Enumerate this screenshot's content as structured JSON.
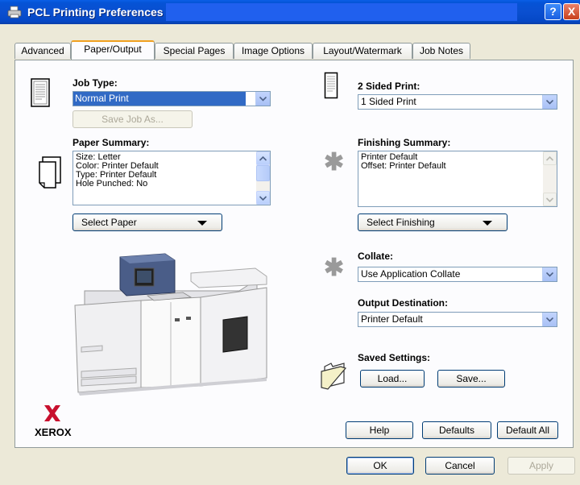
{
  "window": {
    "title": "PCL Printing Preferences",
    "help_glyph": "?",
    "close_glyph": "X"
  },
  "tabs": [
    {
      "label": "Advanced"
    },
    {
      "label": "Paper/Output",
      "active": true
    },
    {
      "label": "Special Pages"
    },
    {
      "label": "Image Options"
    },
    {
      "label": "Layout/Watermark"
    },
    {
      "label": "Job Notes"
    }
  ],
  "job_type": {
    "label": "Job Type:",
    "value": "Normal Print",
    "save_job_as": "Save Job As..."
  },
  "paper_summary": {
    "label": "Paper Summary:",
    "lines": [
      "Size: Letter",
      "Color: Printer Default",
      "Type: Printer Default",
      "Hole Punched: No"
    ],
    "select_button": "Select Paper"
  },
  "two_sided": {
    "label": "2 Sided Print:",
    "value": "1 Sided Print"
  },
  "finishing_summary": {
    "label": "Finishing Summary:",
    "lines": [
      "Printer Default",
      "Offset: Printer Default"
    ],
    "select_button": "Select Finishing"
  },
  "collate": {
    "label": "Collate:",
    "value": "Use Application Collate"
  },
  "output_destination": {
    "label": "Output Destination:",
    "value": "Printer Default"
  },
  "saved_settings": {
    "label": "Saved Settings:",
    "load": "Load...",
    "save": "Save..."
  },
  "brand": {
    "logo_letter": "X",
    "name": "XEROX",
    "color": "#c8102e"
  },
  "panel_buttons": {
    "help": "Help",
    "defaults": "Defaults",
    "default_all": "Default All"
  },
  "dialog_buttons": {
    "ok": "OK",
    "cancel": "Cancel",
    "apply": "Apply"
  },
  "colors": {
    "titlebar": "#0553d6",
    "selection": "#316ac5",
    "tab_highlight": "#f0a020",
    "dialog_bg": "#ece9d8"
  }
}
